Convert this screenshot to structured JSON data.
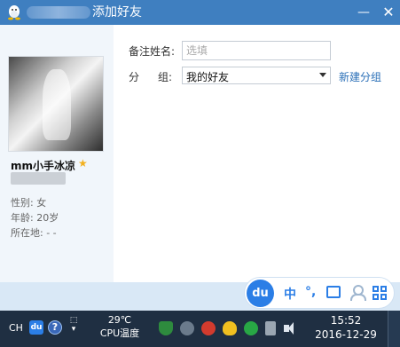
{
  "window": {
    "title": "添加好友",
    "minimize_glyph": "—",
    "close_glyph": "✕"
  },
  "profile": {
    "nickname": "mm小手冰凉",
    "gender": "性别: 女",
    "age": "年龄: 20岁",
    "location": "所在地:  -    -"
  },
  "form": {
    "remark_label": "备注姓名:",
    "remark_placeholder": "选填",
    "group_label_1": "分",
    "group_label_2": "组:",
    "group_value": "我的好友",
    "new_group_link": "新建分组"
  },
  "ime": {
    "logo": "du",
    "mode": "中",
    "punct": "°,"
  },
  "taskbar": {
    "lang": "CH",
    "du": "du",
    "help": "?",
    "temp_value": "29℃",
    "temp_label": "CPU温度",
    "time": "15:52",
    "date": "2016-12-29"
  },
  "colors": {
    "titlebar": "#3f7fc0",
    "link": "#2a6fb7",
    "ime_accent": "#2b7ee6",
    "taskbar": "#1f2f42"
  }
}
